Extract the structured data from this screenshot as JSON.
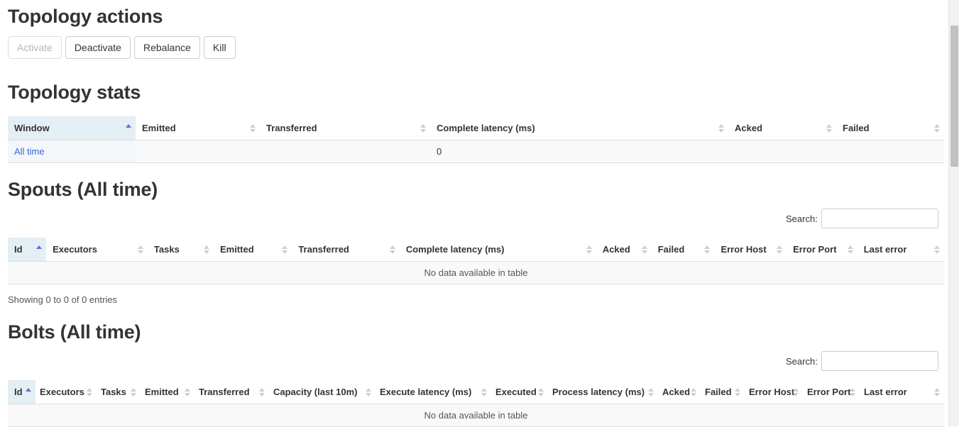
{
  "topology_actions": {
    "title": "Topology actions",
    "buttons": [
      {
        "label": "Activate",
        "disabled": true
      },
      {
        "label": "Deactivate",
        "disabled": false
      },
      {
        "label": "Rebalance",
        "disabled": false
      },
      {
        "label": "Kill",
        "disabled": false
      }
    ]
  },
  "topology_stats": {
    "title": "Topology stats",
    "columns": [
      {
        "label": "Window",
        "sort": "asc"
      },
      {
        "label": "Emitted",
        "sort": "none"
      },
      {
        "label": "Transferred",
        "sort": "none"
      },
      {
        "label": "Complete latency (ms)",
        "sort": "none"
      },
      {
        "label": "Acked",
        "sort": "none"
      },
      {
        "label": "Failed",
        "sort": "none"
      }
    ],
    "rows": [
      {
        "window": "All time",
        "emitted": "",
        "transferred": "",
        "complete_latency": "0",
        "acked": "",
        "failed": ""
      }
    ]
  },
  "spouts": {
    "title": "Spouts (All time)",
    "search_label": "Search:",
    "search_value": "",
    "columns": [
      {
        "label": "Id",
        "sort": "asc"
      },
      {
        "label": "Executors",
        "sort": "none"
      },
      {
        "label": "Tasks",
        "sort": "none"
      },
      {
        "label": "Emitted",
        "sort": "none"
      },
      {
        "label": "Transferred",
        "sort": "none"
      },
      {
        "label": "Complete latency (ms)",
        "sort": "none"
      },
      {
        "label": "Acked",
        "sort": "none"
      },
      {
        "label": "Failed",
        "sort": "none"
      },
      {
        "label": "Error Host",
        "sort": "none"
      },
      {
        "label": "Error Port",
        "sort": "none"
      },
      {
        "label": "Last error",
        "sort": "none"
      }
    ],
    "empty_text": "No data available in table",
    "info_text": "Showing 0 to 0 of 0 entries"
  },
  "bolts": {
    "title": "Bolts (All time)",
    "search_label": "Search:",
    "search_value": "",
    "columns": [
      {
        "label": "Id",
        "sort": "asc"
      },
      {
        "label": "Executors",
        "sort": "none"
      },
      {
        "label": "Tasks",
        "sort": "none"
      },
      {
        "label": "Emitted",
        "sort": "none"
      },
      {
        "label": "Transferred",
        "sort": "none"
      },
      {
        "label": "Capacity (last 10m)",
        "sort": "none"
      },
      {
        "label": "Execute latency (ms)",
        "sort": "none"
      },
      {
        "label": "Executed",
        "sort": "none"
      },
      {
        "label": "Process latency (ms)",
        "sort": "none"
      },
      {
        "label": "Acked",
        "sort": "none"
      },
      {
        "label": "Failed",
        "sort": "none"
      },
      {
        "label": "Error Host",
        "sort": "none"
      },
      {
        "label": "Error Port",
        "sort": "none"
      },
      {
        "label": "Last error",
        "sort": "none"
      }
    ],
    "empty_text": "No data available in table"
  },
  "colors": {
    "sorted_header_bg": "#e3eef5",
    "sort_asc_arrow": "#6a6acb",
    "link": "#3366dd",
    "row_bg": "#f9f9f9",
    "border": "#dddddd"
  },
  "scrollbar": {
    "present": true
  }
}
